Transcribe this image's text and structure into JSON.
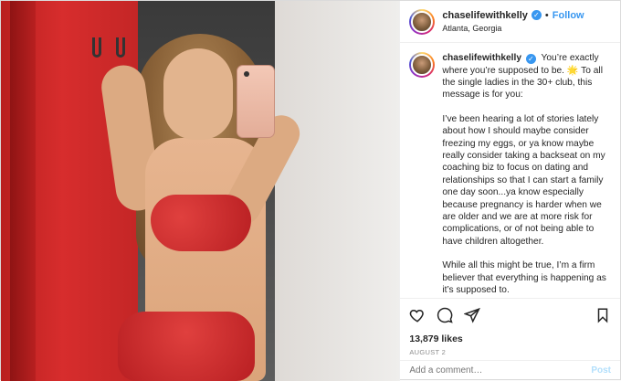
{
  "header": {
    "username": "chaselifewithkelly",
    "verified_glyph": "✓",
    "separator": "•",
    "follow_label": "Follow",
    "location": "Atlanta, Georgia"
  },
  "caption": {
    "username": "chaselifewithkelly",
    "paragraph1": "You’re exactly where you’re supposed to be. 🌟 To all the single ladies in the 30+ club, this message is for you:",
    "paragraph2": "I’ve been hearing a lot of stories lately about how I should maybe consider freezing my eggs, or ya know maybe really consider taking a backseat on my coaching biz to focus on dating and relationships so that I can start a family one day soon...ya know especially because pregnancy is harder when we are older and we are at more risk for complications, or of not being able to have children altogether.",
    "paragraph3": "While all this might be true, I’m a firm believer that everything is happening as it’s supposed to."
  },
  "actions": {
    "like_icon": "heart-icon",
    "comment_icon": "comment-icon",
    "share_icon": "send-icon",
    "save_icon": "bookmark-icon"
  },
  "likes": "13,879 likes",
  "date": "AUGUST 2",
  "add_comment": {
    "placeholder": "Add a comment…",
    "post_label": "Post"
  },
  "colors": {
    "accent": "#3897f0",
    "text": "#262626",
    "muted": "#8e8e8e"
  }
}
